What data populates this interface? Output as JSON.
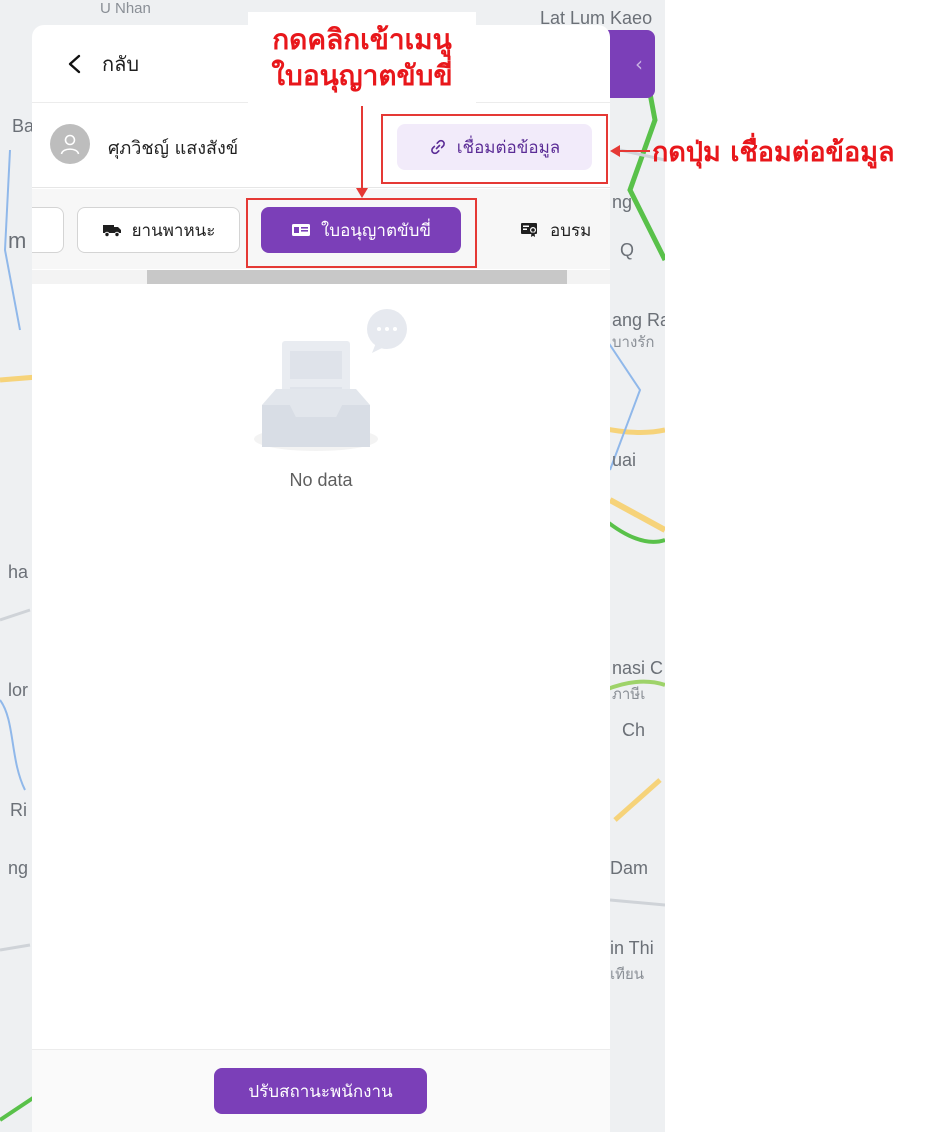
{
  "map": {
    "labels": [
      {
        "text": "Lat Lum Kaeo"
      },
      {
        "text": "U Nhan"
      },
      {
        "text": "Ba"
      },
      {
        "text": "m"
      },
      {
        "text": "ng"
      },
      {
        "text": "Q"
      },
      {
        "text": "ang Ra"
      },
      {
        "text": "บางรัก"
      },
      {
        "text": "uai"
      },
      {
        "text": "ha"
      },
      {
        "text": "lor"
      },
      {
        "text": "nasi C"
      },
      {
        "text": "ภาษีเ"
      },
      {
        "text": "Ch"
      },
      {
        "text": "Ri"
      },
      {
        "text": "ng"
      },
      {
        "text": "Dam"
      },
      {
        "text": "in Thi"
      },
      {
        "text": "เทียน"
      }
    ],
    "collapse_icon": "chevron-left-icon"
  },
  "header": {
    "back_icon": "chevron-left-icon",
    "back_label": "กลับ"
  },
  "user": {
    "avatar_icon": "user-icon",
    "name": "ศุภวิชญ์ แสงสังข์",
    "connect_icon": "link-icon",
    "connect_label": "เชื่อมต่อข้อมูล"
  },
  "tabs": [
    {
      "label": "",
      "icon": "",
      "active": false
    },
    {
      "label": "ยานพาหนะ",
      "icon": "truck-icon",
      "active": false
    },
    {
      "label": "ใบอนุญาตขับขี่",
      "icon": "id-card-icon",
      "active": true
    },
    {
      "label": "อบรม",
      "icon": "certificate-icon",
      "active": false
    }
  ],
  "empty_state": {
    "icon": "empty-inbox-icon",
    "text": "No data"
  },
  "footer": {
    "button_label": "ปรับสถานะพนักงาน"
  },
  "annotations": {
    "menu_instruction_line1": "กดคลิกเข้าเมนู",
    "menu_instruction_line2": "ใบอนุญาตขับขี่",
    "connect_instruction": "กดปุ่ม เชื่อมต่อข้อมูล",
    "color": "#e8171b"
  },
  "colors": {
    "brand_purple": "#7b3fb8",
    "connect_bg": "#f2ebfa"
  }
}
